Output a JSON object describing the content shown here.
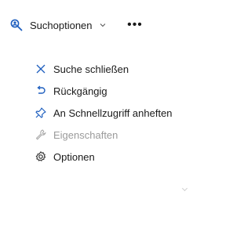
{
  "toolbar": {
    "search_options_label": "Suchoptionen",
    "search_icon": "search-person-icon",
    "more_label": "•••"
  },
  "colors": {
    "accent": "#1f5fbf",
    "disabled": "#9a9a9a"
  },
  "menu": {
    "items": [
      {
        "label": "Suche schließen",
        "icon": "close-x-icon",
        "enabled": true
      },
      {
        "label": "Rückgängig",
        "icon": "undo-icon",
        "enabled": true
      },
      {
        "label": "An Schnellzugriff anheften",
        "icon": "pin-icon",
        "enabled": true
      },
      {
        "label": "Eigenschaften",
        "icon": "wrench-icon",
        "enabled": false
      },
      {
        "label": "Optionen",
        "icon": "gear-icon",
        "enabled": true
      }
    ]
  }
}
